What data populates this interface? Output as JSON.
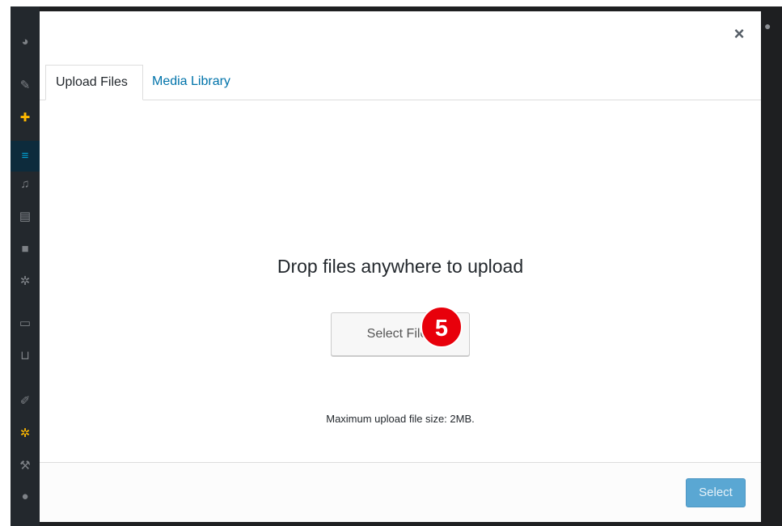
{
  "modal": {
    "close_icon": "×",
    "tabs": [
      {
        "label": "Upload Files",
        "active": true
      },
      {
        "label": "Media Library",
        "active": false
      }
    ],
    "uploader": {
      "title": "Drop files anywhere to upload",
      "select_files_label": "Select Files",
      "max_size_text": "Maximum upload file size: 2MB."
    },
    "toolbar": {
      "select_label": "Select",
      "select_disabled": true
    }
  },
  "annotation": {
    "step_number": "5",
    "color": "#e8000b"
  },
  "sidebar_icons": [
    "dashboard-icon",
    "pin-icon",
    "plus-icon",
    "menu-icon",
    "media-icon",
    "pages-icon",
    "comments-icon",
    "gear-icon",
    "woo-icon",
    "cart-icon",
    "brush-icon",
    "gear-icon",
    "plugin-icon",
    "user-icon"
  ],
  "colors": {
    "link": "#0073aa",
    "primary_button": "#5aa7d3",
    "admin_bar": "#23282d"
  }
}
